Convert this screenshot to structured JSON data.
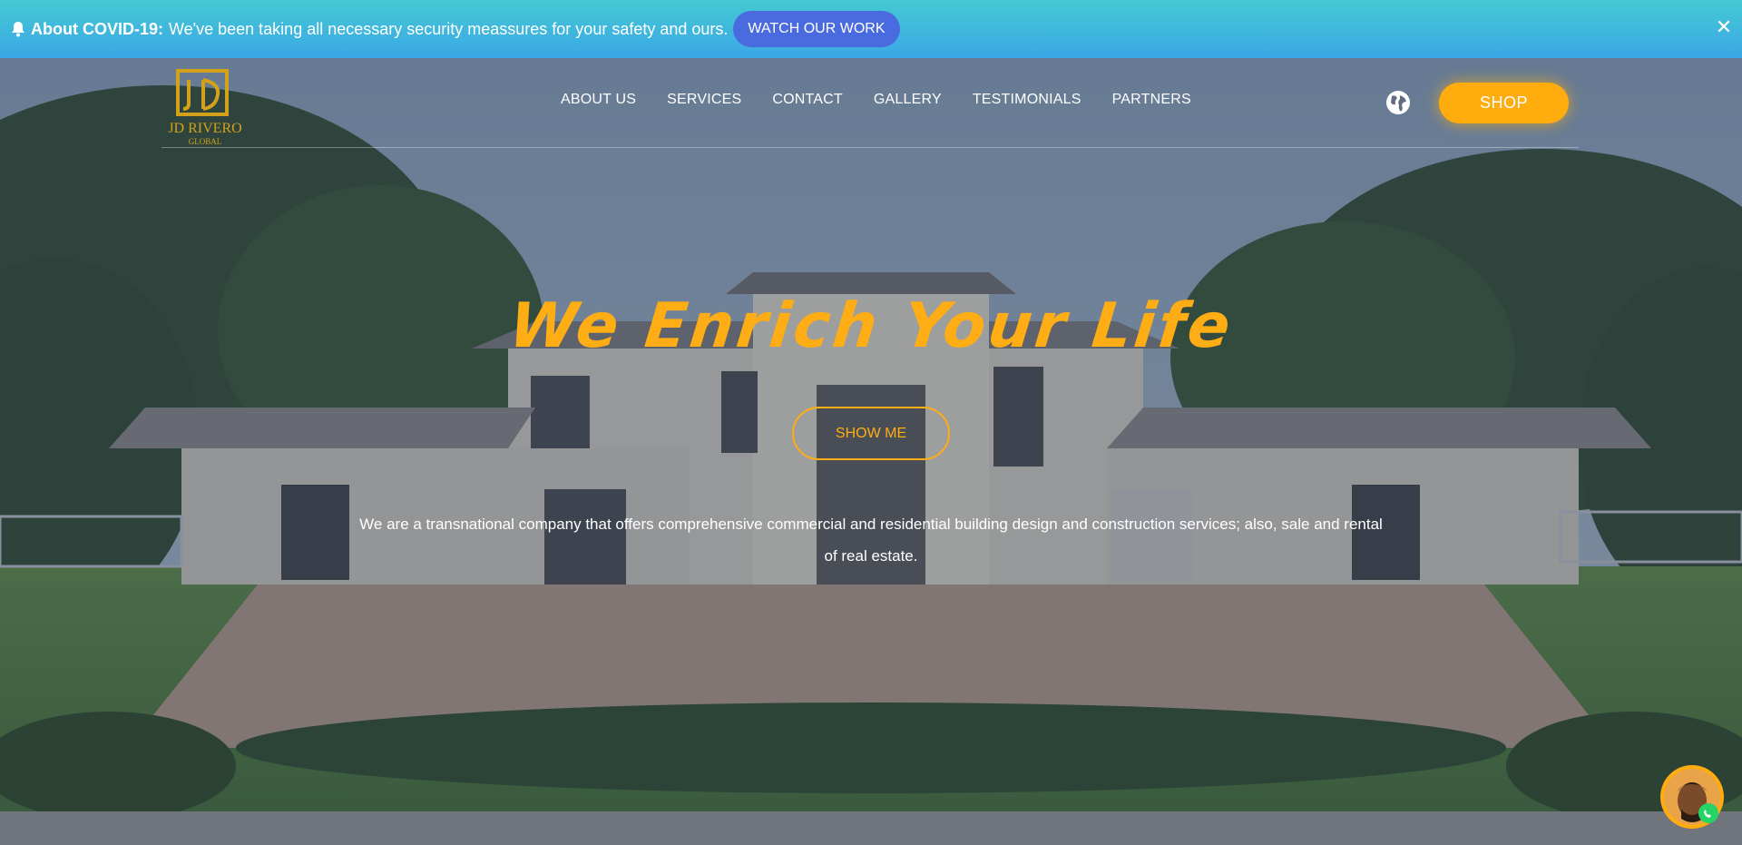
{
  "announcement": {
    "title": "About COVID-19:",
    "message": "We've been taking all necessary security meassures for your safety and ours.",
    "button_label": "WATCH OUR WORK",
    "close_label": "✕"
  },
  "brand": {
    "logo_text": "JD RIVERO",
    "logo_sub": "GLOBAL",
    "accent_color": "#ffac0e"
  },
  "nav": {
    "items": [
      {
        "label": "ABOUT US"
      },
      {
        "label": "SERVICES"
      },
      {
        "label": "CONTACT"
      },
      {
        "label": "GALLERY"
      },
      {
        "label": "TESTIMONIALS"
      },
      {
        "label": "PARTNERS"
      }
    ],
    "language_icon": "globe-icon",
    "shop_label": "SHOP"
  },
  "hero": {
    "headline": "We Enrich Your Life",
    "cta_label": "SHOW ME",
    "description": "We are a transnational company that offers comprehensive commercial and residential building design and construction services; also, sale and rental of real estate."
  },
  "chat": {
    "icon": "whatsapp-icon"
  }
}
